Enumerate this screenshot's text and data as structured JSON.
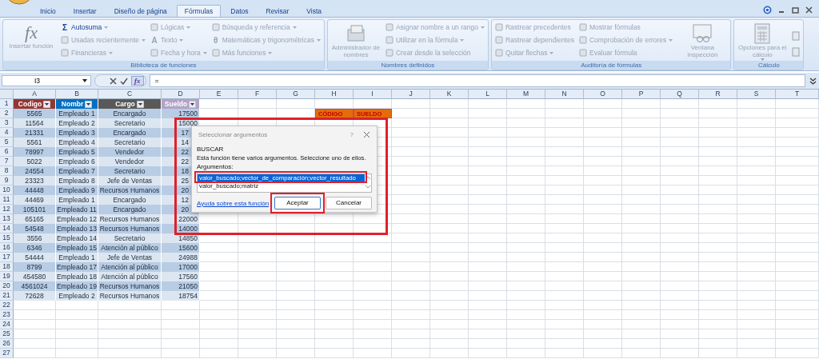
{
  "tabs": [
    {
      "label": "Inicio",
      "selected": false
    },
    {
      "label": "Insertar",
      "selected": false
    },
    {
      "label": "Diseño de página",
      "selected": false
    },
    {
      "label": "Fórmulas",
      "selected": true
    },
    {
      "label": "Datos",
      "selected": false
    },
    {
      "label": "Revisar",
      "selected": false
    },
    {
      "label": "Vista",
      "selected": false
    }
  ],
  "ribbon": [
    {
      "label": "Biblioteca de funciones",
      "parts": [
        {
          "kind": "large",
          "label": "Insertar función",
          "glyph": "fx",
          "disabled": true,
          "dropdown": false
        },
        {
          "kind": "column",
          "items": [
            {
              "label": "Autosuma",
              "glyph": "Σ",
              "disabled": false,
              "dropdown": true
            },
            {
              "label": "Usadas recientemente",
              "disabled": true,
              "dropdown": true
            },
            {
              "label": "Financieras",
              "disabled": true,
              "dropdown": true
            }
          ]
        },
        {
          "kind": "column",
          "items": [
            {
              "label": "Lógicas",
              "disabled": true,
              "dropdown": true
            },
            {
              "label": "Texto",
              "glyph": "A",
              "disabled": true,
              "dropdown": true
            },
            {
              "label": "Fecha y hora",
              "disabled": true,
              "dropdown": true
            }
          ]
        },
        {
          "kind": "column",
          "items": [
            {
              "label": "Búsqueda y referencia",
              "disabled": true,
              "dropdown": true
            },
            {
              "label": "Matemáticas y trigonométricas",
              "glyph": "θ",
              "disabled": true,
              "dropdown": true
            },
            {
              "label": "Más funciones",
              "disabled": true,
              "dropdown": true
            }
          ]
        }
      ]
    },
    {
      "label": "Nombres definidos",
      "parts": [
        {
          "kind": "large",
          "label": "Administrador de nombres",
          "disabled": true,
          "dropdown": false
        },
        {
          "kind": "column",
          "items": [
            {
              "label": "Asignar nombre a un rango",
              "disabled": true,
              "dropdown": true
            },
            {
              "label": "Utilizar en la fórmula",
              "disabled": true,
              "dropdown": true
            },
            {
              "label": "Crear desde la selección",
              "disabled": true,
              "dropdown": false
            }
          ]
        }
      ]
    },
    {
      "label": "Auditoría de fórmulas",
      "parts": [
        {
          "kind": "column",
          "items": [
            {
              "label": "Rastrear precedentes",
              "disabled": true,
              "dropdown": false
            },
            {
              "label": "Rastrear dependientes",
              "disabled": true,
              "dropdown": false
            },
            {
              "label": "Quitar flechas",
              "disabled": true,
              "dropdown": true
            }
          ]
        },
        {
          "kind": "column",
          "items": [
            {
              "label": "Mostrar fórmulas",
              "disabled": true,
              "dropdown": false
            },
            {
              "label": "Comprobación de errores",
              "disabled": true,
              "dropdown": true
            },
            {
              "label": "Evaluar fórmula",
              "disabled": true,
              "dropdown": false
            }
          ]
        },
        {
          "kind": "large",
          "label": "Ventana Inspección",
          "disabled": true,
          "dropdown": false
        }
      ]
    },
    {
      "label": "Cálculo",
      "parts": [
        {
          "kind": "large",
          "label": "Opciones para el cálculo",
          "disabled": true,
          "dropdown": true
        },
        {
          "kind": "icons"
        }
      ]
    }
  ],
  "formula_bar": {
    "name_box": "I3",
    "fx": "fx",
    "value": "="
  },
  "columns": [
    "A",
    "B",
    "C",
    "D",
    "E",
    "F",
    "G",
    "H",
    "I",
    "J",
    "K",
    "L",
    "M",
    "N",
    "O",
    "P",
    "Q",
    "R",
    "S",
    "T"
  ],
  "row_numbers": [
    "1",
    "2",
    "3",
    "4",
    "5",
    "6",
    "7",
    "8",
    "9",
    "10",
    "11",
    "12",
    "13",
    "14",
    "15",
    "16",
    "17",
    "18",
    "19",
    "20",
    "21",
    "22",
    "23",
    "24",
    "25",
    "26",
    "27"
  ],
  "table": {
    "headers": [
      {
        "label": "Codigo",
        "color": "#953735"
      },
      {
        "label": "Nombr",
        "color": "#0070c0"
      },
      {
        "label": "Cargo",
        "color": "#595959"
      },
      {
        "label": "Sueldo",
        "color": "#b3a2c7"
      }
    ],
    "rows": [
      {
        "cells": [
          "5565",
          "Empleado 1",
          "Encargado",
          "17500"
        ],
        "covered": false
      },
      {
        "cells": [
          "11564",
          "Empleado 2",
          "Secretario",
          "15000"
        ],
        "covered": false
      },
      {
        "cells": [
          "21331",
          "Empleado 3",
          "Encargado",
          "17"
        ],
        "covered": true
      },
      {
        "cells": [
          "5561",
          "Empleado 4",
          "Secretario",
          "14"
        ],
        "covered": true
      },
      {
        "cells": [
          "78997",
          "Empleado 5",
          "Vendedor",
          "22"
        ],
        "covered": true
      },
      {
        "cells": [
          "5022",
          "Empleado 6",
          "Vendedor",
          "22"
        ],
        "covered": true
      },
      {
        "cells": [
          "24554",
          "Empleado 7",
          "Secretario",
          "18"
        ],
        "covered": true
      },
      {
        "cells": [
          "23323",
          "Empleado 8",
          "Jefe de Ventas",
          "25"
        ],
        "covered": true
      },
      {
        "cells": [
          "44448",
          "Empleado 9",
          "Recursos Humanos",
          "20"
        ],
        "covered": true
      },
      {
        "cells": [
          "44469",
          "Empleado 1",
          "Encargado",
          "12"
        ],
        "covered": true
      },
      {
        "cells": [
          "105101",
          "Empleado 11",
          "Encargado",
          "20"
        ],
        "covered": true
      },
      {
        "cells": [
          "65165",
          "Empleado 12",
          "Recursos Humanos",
          "22000"
        ],
        "covered": false
      },
      {
        "cells": [
          "54548",
          "Empleado 13",
          "Recursos Humanos",
          "14000"
        ],
        "covered": false
      },
      {
        "cells": [
          "3556",
          "Empleado 14",
          "Secretario",
          "14850"
        ],
        "covered": false
      },
      {
        "cells": [
          "6346",
          "Empleado 15",
          "Atención al público",
          "15600"
        ],
        "covered": false
      },
      {
        "cells": [
          "54444",
          "Empleado 1",
          "Jefe de Ventas",
          "24988"
        ],
        "covered": false
      },
      {
        "cells": [
          "8799",
          "Empleado 17",
          "Atención al público",
          "17000"
        ],
        "covered": false
      },
      {
        "cells": [
          "454580",
          "Empleado 18",
          "Atención al público",
          "17560"
        ],
        "covered": false
      },
      {
        "cells": [
          "4561024",
          "Empleado 19",
          "Recursos Humanos",
          "21050"
        ],
        "covered": false
      },
      {
        "cells": [
          "72628",
          "Empleado 2",
          "Recursos Humanos",
          "18754"
        ],
        "covered": false
      }
    ]
  },
  "lookup_headers": [
    "CÓDIGO",
    "SUELDO"
  ],
  "dialog": {
    "title": "Seleccionar argumentos",
    "help": "?",
    "function": "BUSCAR",
    "message": "Esta función tiene varios argumentos. Seleccione uno de ellos.",
    "list_label": "Argumentos:",
    "options": [
      {
        "label": "valor_buscado;vector_de_comparación;vector_resultado",
        "selected": true
      },
      {
        "label": "valor_buscado;matriz",
        "selected": false
      }
    ],
    "link": "Ayuda sobre esta función",
    "buttons": [
      {
        "label": "Aceptar",
        "default": true
      },
      {
        "label": "Cancelar",
        "default": false
      }
    ]
  }
}
